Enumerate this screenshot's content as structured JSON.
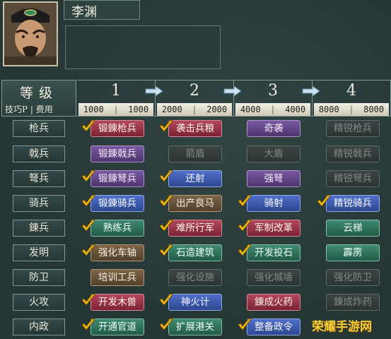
{
  "officer": {
    "name": "李渊"
  },
  "header": {
    "level_label": "等级",
    "sub_label": "技巧P | 费用",
    "levels": [
      {
        "num": "1",
        "cost_a": "1000",
        "cost_b": "1000"
      },
      {
        "num": "2",
        "cost_a": "2000",
        "cost_b": "2000"
      },
      {
        "num": "3",
        "cost_a": "4000",
        "cost_b": "4000"
      },
      {
        "num": "4",
        "cost_a": "8000",
        "cost_b": "8000"
      }
    ]
  },
  "rows": [
    {
      "label": "枪兵",
      "cells": [
        {
          "text": "锻錬枪兵",
          "style": "red",
          "checked": true
        },
        {
          "text": "袭击兵粮",
          "style": "red",
          "checked": true
        },
        {
          "text": "奇袭",
          "style": "purple",
          "checked": false
        },
        {
          "text": "精锐枪兵",
          "style": "gray",
          "checked": false
        }
      ]
    },
    {
      "label": "戟兵",
      "cells": [
        {
          "text": "锻錬戟兵",
          "style": "purple",
          "checked": false
        },
        {
          "text": "箭盾",
          "style": "gray",
          "checked": false
        },
        {
          "text": "大盾",
          "style": "gray",
          "checked": false
        },
        {
          "text": "精锐戟兵",
          "style": "gray",
          "checked": false
        }
      ]
    },
    {
      "label": "弩兵",
      "cells": [
        {
          "text": "锻錬弩兵",
          "style": "purple",
          "checked": true
        },
        {
          "text": "还射",
          "style": "blue",
          "checked": true
        },
        {
          "text": "强弩",
          "style": "purple",
          "checked": false
        },
        {
          "text": "精锐弩兵",
          "style": "gray",
          "checked": false
        }
      ]
    },
    {
      "label": "骑兵",
      "cells": [
        {
          "text": "锻錬骑兵",
          "style": "blue",
          "checked": true
        },
        {
          "text": "出产良马",
          "style": "brown",
          "checked": true
        },
        {
          "text": "骑射",
          "style": "blue",
          "checked": true
        },
        {
          "text": "精锐骑兵",
          "style": "blue",
          "checked": true
        }
      ]
    },
    {
      "label": "錬兵",
      "cells": [
        {
          "text": "熟练兵",
          "style": "green",
          "checked": true
        },
        {
          "text": "难所行军",
          "style": "red",
          "checked": true
        },
        {
          "text": "军制改革",
          "style": "red",
          "checked": true
        },
        {
          "text": "云梯",
          "style": "green",
          "checked": false
        }
      ]
    },
    {
      "label": "发明",
      "cells": [
        {
          "text": "强化车轴",
          "style": "brown",
          "checked": true
        },
        {
          "text": "石造建筑",
          "style": "green",
          "checked": true
        },
        {
          "text": "开发投石",
          "style": "green",
          "checked": true
        },
        {
          "text": "霹雳",
          "style": "green",
          "checked": false
        }
      ]
    },
    {
      "label": "防卫",
      "cells": [
        {
          "text": "培训工兵",
          "style": "brown",
          "checked": false
        },
        {
          "text": "强化设施",
          "style": "gray",
          "checked": false
        },
        {
          "text": "强化城墙",
          "style": "gray",
          "checked": false
        },
        {
          "text": "强化防卫",
          "style": "gray",
          "checked": false
        }
      ]
    },
    {
      "label": "火攻",
      "cells": [
        {
          "text": "开发木兽",
          "style": "red",
          "checked": true
        },
        {
          "text": "神火计",
          "style": "blue",
          "checked": true
        },
        {
          "text": "錬成火药",
          "style": "red",
          "checked": false
        },
        {
          "text": "錬成炸药",
          "style": "gray",
          "checked": false
        }
      ]
    },
    {
      "label": "内政",
      "cells": [
        {
          "text": "开通官道",
          "style": "green",
          "checked": true
        },
        {
          "text": "扩展港关",
          "style": "green",
          "checked": true
        },
        {
          "text": "整备政令",
          "style": "blue",
          "checked": true
        },
        {
          "text": "",
          "style": "none",
          "checked": false
        }
      ]
    }
  ],
  "watermark": {
    "text": "荣耀手游网"
  },
  "icons": {
    "check": "checkmark-icon",
    "arrow": "right-arrow-icon"
  },
  "colors": {
    "red": "#9a3448",
    "blue": "#3d5bae",
    "purple": "#634586",
    "green": "#30745a",
    "brown": "#6a5339",
    "gray": "#343d3c"
  }
}
